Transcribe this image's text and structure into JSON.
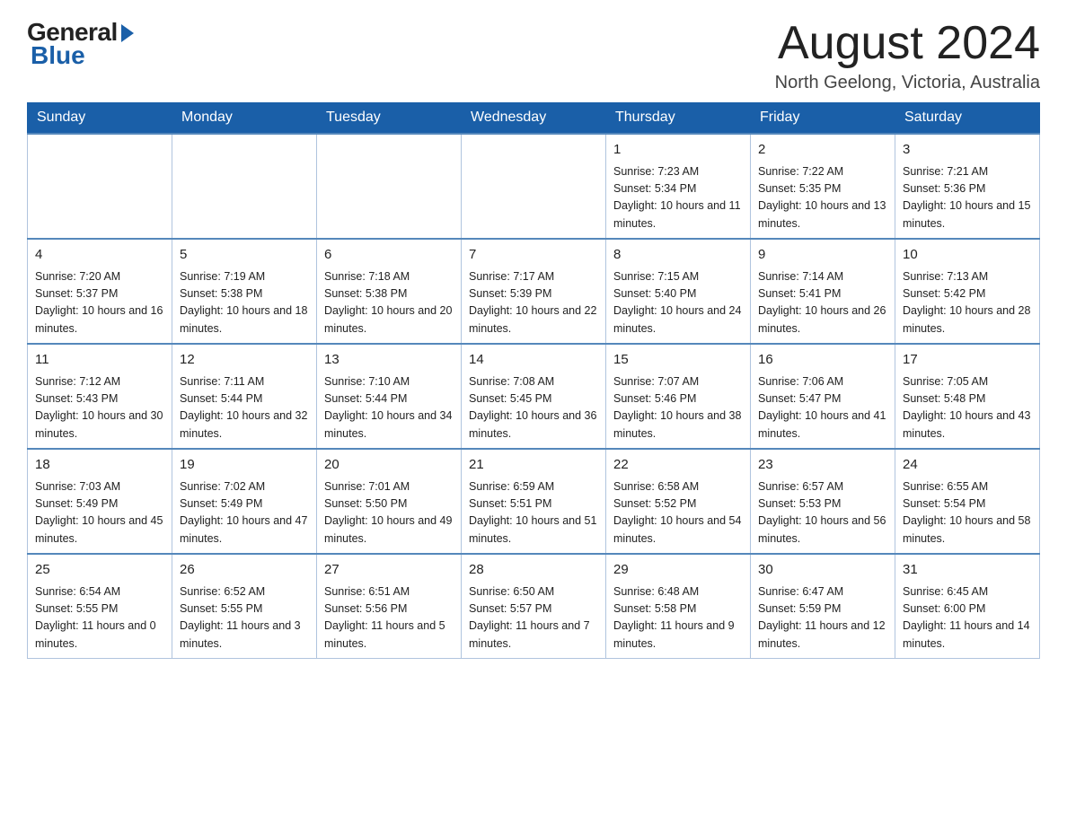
{
  "header": {
    "logo": {
      "general": "General",
      "blue": "Blue",
      "tagline": "Blue"
    },
    "month_title": "August 2024",
    "location": "North Geelong, Victoria, Australia"
  },
  "days_of_week": [
    "Sunday",
    "Monday",
    "Tuesday",
    "Wednesday",
    "Thursday",
    "Friday",
    "Saturday"
  ],
  "weeks": [
    [
      {
        "day": "",
        "info": ""
      },
      {
        "day": "",
        "info": ""
      },
      {
        "day": "",
        "info": ""
      },
      {
        "day": "",
        "info": ""
      },
      {
        "day": "1",
        "info": "Sunrise: 7:23 AM\nSunset: 5:34 PM\nDaylight: 10 hours and 11 minutes."
      },
      {
        "day": "2",
        "info": "Sunrise: 7:22 AM\nSunset: 5:35 PM\nDaylight: 10 hours and 13 minutes."
      },
      {
        "day": "3",
        "info": "Sunrise: 7:21 AM\nSunset: 5:36 PM\nDaylight: 10 hours and 15 minutes."
      }
    ],
    [
      {
        "day": "4",
        "info": "Sunrise: 7:20 AM\nSunset: 5:37 PM\nDaylight: 10 hours and 16 minutes."
      },
      {
        "day": "5",
        "info": "Sunrise: 7:19 AM\nSunset: 5:38 PM\nDaylight: 10 hours and 18 minutes."
      },
      {
        "day": "6",
        "info": "Sunrise: 7:18 AM\nSunset: 5:38 PM\nDaylight: 10 hours and 20 minutes."
      },
      {
        "day": "7",
        "info": "Sunrise: 7:17 AM\nSunset: 5:39 PM\nDaylight: 10 hours and 22 minutes."
      },
      {
        "day": "8",
        "info": "Sunrise: 7:15 AM\nSunset: 5:40 PM\nDaylight: 10 hours and 24 minutes."
      },
      {
        "day": "9",
        "info": "Sunrise: 7:14 AM\nSunset: 5:41 PM\nDaylight: 10 hours and 26 minutes."
      },
      {
        "day": "10",
        "info": "Sunrise: 7:13 AM\nSunset: 5:42 PM\nDaylight: 10 hours and 28 minutes."
      }
    ],
    [
      {
        "day": "11",
        "info": "Sunrise: 7:12 AM\nSunset: 5:43 PM\nDaylight: 10 hours and 30 minutes."
      },
      {
        "day": "12",
        "info": "Sunrise: 7:11 AM\nSunset: 5:44 PM\nDaylight: 10 hours and 32 minutes."
      },
      {
        "day": "13",
        "info": "Sunrise: 7:10 AM\nSunset: 5:44 PM\nDaylight: 10 hours and 34 minutes."
      },
      {
        "day": "14",
        "info": "Sunrise: 7:08 AM\nSunset: 5:45 PM\nDaylight: 10 hours and 36 minutes."
      },
      {
        "day": "15",
        "info": "Sunrise: 7:07 AM\nSunset: 5:46 PM\nDaylight: 10 hours and 38 minutes."
      },
      {
        "day": "16",
        "info": "Sunrise: 7:06 AM\nSunset: 5:47 PM\nDaylight: 10 hours and 41 minutes."
      },
      {
        "day": "17",
        "info": "Sunrise: 7:05 AM\nSunset: 5:48 PM\nDaylight: 10 hours and 43 minutes."
      }
    ],
    [
      {
        "day": "18",
        "info": "Sunrise: 7:03 AM\nSunset: 5:49 PM\nDaylight: 10 hours and 45 minutes."
      },
      {
        "day": "19",
        "info": "Sunrise: 7:02 AM\nSunset: 5:49 PM\nDaylight: 10 hours and 47 minutes."
      },
      {
        "day": "20",
        "info": "Sunrise: 7:01 AM\nSunset: 5:50 PM\nDaylight: 10 hours and 49 minutes."
      },
      {
        "day": "21",
        "info": "Sunrise: 6:59 AM\nSunset: 5:51 PM\nDaylight: 10 hours and 51 minutes."
      },
      {
        "day": "22",
        "info": "Sunrise: 6:58 AM\nSunset: 5:52 PM\nDaylight: 10 hours and 54 minutes."
      },
      {
        "day": "23",
        "info": "Sunrise: 6:57 AM\nSunset: 5:53 PM\nDaylight: 10 hours and 56 minutes."
      },
      {
        "day": "24",
        "info": "Sunrise: 6:55 AM\nSunset: 5:54 PM\nDaylight: 10 hours and 58 minutes."
      }
    ],
    [
      {
        "day": "25",
        "info": "Sunrise: 6:54 AM\nSunset: 5:55 PM\nDaylight: 11 hours and 0 minutes."
      },
      {
        "day": "26",
        "info": "Sunrise: 6:52 AM\nSunset: 5:55 PM\nDaylight: 11 hours and 3 minutes."
      },
      {
        "day": "27",
        "info": "Sunrise: 6:51 AM\nSunset: 5:56 PM\nDaylight: 11 hours and 5 minutes."
      },
      {
        "day": "28",
        "info": "Sunrise: 6:50 AM\nSunset: 5:57 PM\nDaylight: 11 hours and 7 minutes."
      },
      {
        "day": "29",
        "info": "Sunrise: 6:48 AM\nSunset: 5:58 PM\nDaylight: 11 hours and 9 minutes."
      },
      {
        "day": "30",
        "info": "Sunrise: 6:47 AM\nSunset: 5:59 PM\nDaylight: 11 hours and 12 minutes."
      },
      {
        "day": "31",
        "info": "Sunrise: 6:45 AM\nSunset: 6:00 PM\nDaylight: 11 hours and 14 minutes."
      }
    ]
  ]
}
